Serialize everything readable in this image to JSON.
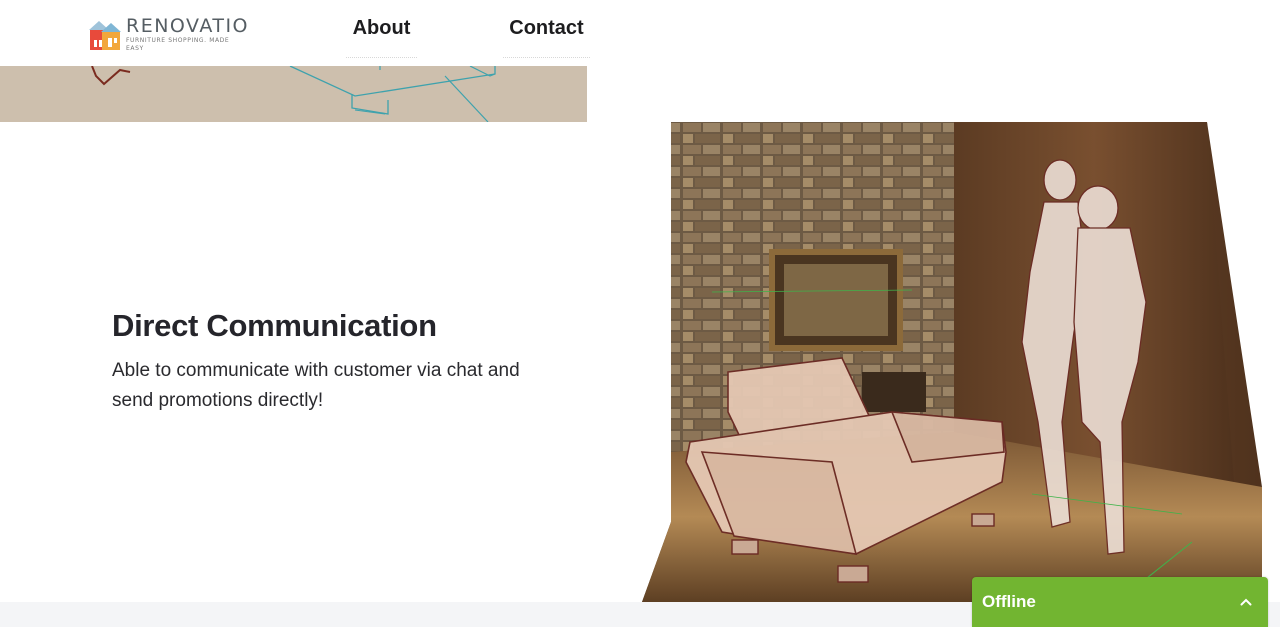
{
  "header": {
    "logo": {
      "name": "RENOVATIO",
      "tagline": "FURNITURE SHOPPING. MADE EASY"
    },
    "nav": [
      {
        "label": "About"
      },
      {
        "label": "Contact"
      }
    ]
  },
  "feature": {
    "title": "Direct Communication",
    "description": "Able to communicate with customer via chat and send promotions directly!"
  },
  "chat_widget": {
    "status": "Offline",
    "color": "#72b531",
    "icon": "chevron-up-icon"
  },
  "colors": {
    "banner_bg": "#cdbfad",
    "footer_bg": "#f4f5f7"
  }
}
